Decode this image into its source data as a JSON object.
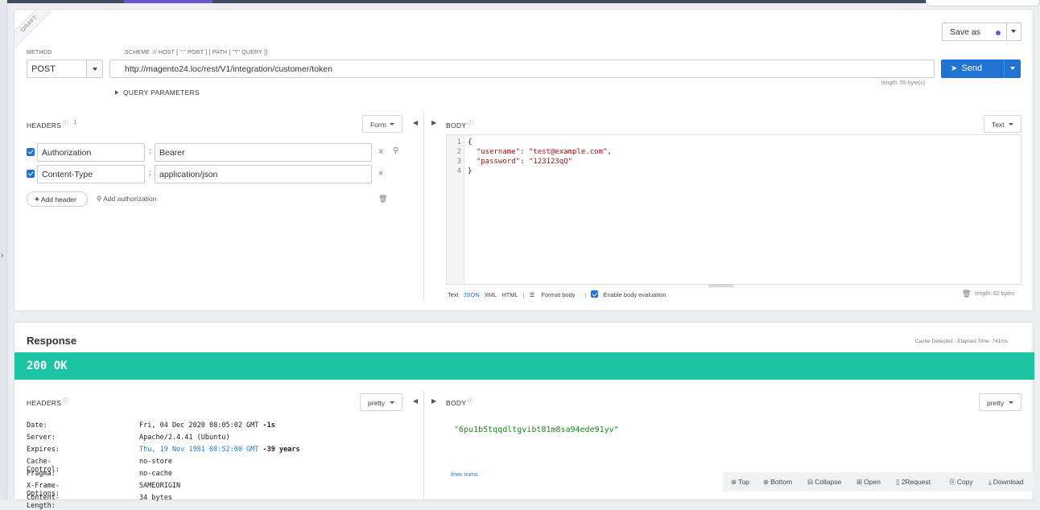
{
  "request": {
    "ribbon": "DRAFT",
    "method_label": "METHOD",
    "method_value": "POST",
    "url_hint": "SCHEME :// HOST [ \":\" PORT ] [ PATH [ \"?\" QUERY ]]",
    "url_value": "http://magento24.loc/rest/V1/integration/customer/token",
    "url_length": "length: 55 byte(s)",
    "save_as_label": "Save as",
    "send_label": "Send",
    "query_params_label": "QUERY PARAMETERS",
    "headers_title": "HEADERS",
    "headers_mode": "Form",
    "headers": [
      {
        "name": "Authorization",
        "value": "Bearer"
      },
      {
        "name": "Content-Type",
        "value": "application/json"
      }
    ],
    "add_header_label": "Add header",
    "add_auth_label": "Add authorization",
    "body_title": "BODY",
    "body_mode": "Text",
    "body_lines": [
      "1",
      "2",
      "3",
      "4"
    ],
    "body_code": {
      "l1": "{",
      "l2_key": "\"username\"",
      "l2_val": "\"test@example.com\"",
      "l3_key": "\"password\"",
      "l3_val": "\"123123qQ\"",
      "l4": "}"
    },
    "body_formats": [
      "Text",
      "JSON",
      "XML",
      "HTML"
    ],
    "format_body_label": "Format body",
    "enable_eval_label": "Enable body evaluation",
    "body_length": "length: 62 bytes"
  },
  "response": {
    "title": "Response",
    "elapsed": "Cache Detected - Elapsed Time: 741ms",
    "status": "200 OK",
    "status_color": "#1cc3a5",
    "headers_title": "HEADERS",
    "headers_mode": "pretty",
    "body_title": "BODY",
    "body_mode": "pretty",
    "headers": [
      {
        "name": "Date:",
        "value": "Fri, 04 Dec 2020 08:05:02 GMT",
        "extra": "-1s"
      },
      {
        "name": "Server:",
        "value": "Apache/2.4.41 (Ubuntu)",
        "extra": ""
      },
      {
        "name": "Expires:",
        "value": "Thu, 19 Nov 1981 08:52:00 GMT",
        "extra": "-39 years"
      },
      {
        "name": "Cache-Control:",
        "value": "no-store",
        "extra": ""
      },
      {
        "name": "Pragma:",
        "value": "no-cache",
        "extra": ""
      },
      {
        "name": "X-Frame-Options:",
        "value": "SAMEORIGIN",
        "extra": ""
      },
      {
        "name": "Content-Length:",
        "value": "34 bytes",
        "extra": ""
      }
    ],
    "body_value": "\"6pu1b5tqqdltgvibt81m8sa94ede91yv\"",
    "line_nums_label": "lines nums",
    "toolbar": {
      "top": "Top",
      "bottom": "Bottom",
      "collapse": "Collapse",
      "open": "Open",
      "to_request": "2Request",
      "copy": "Copy",
      "download": "Download"
    }
  },
  "colors": {
    "accent": "#1f73d3",
    "success": "#1cc3a5",
    "save_dot": "#5a5fd6"
  }
}
